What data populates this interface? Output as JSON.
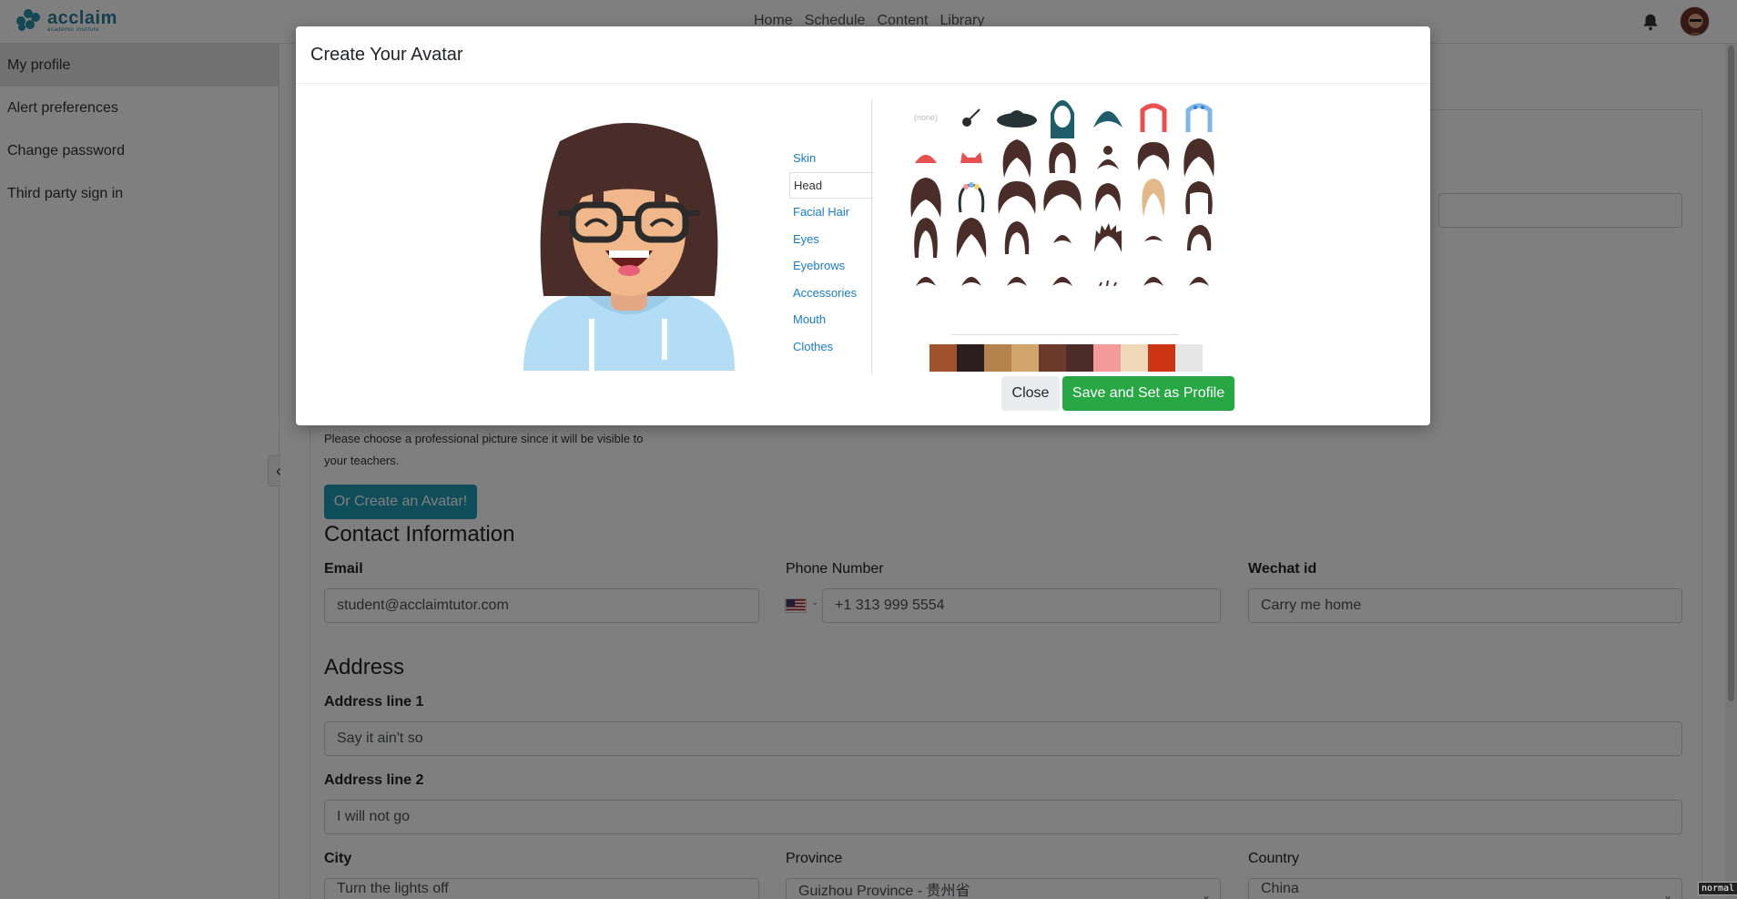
{
  "brand": {
    "name": "acclaim",
    "subtitle": "academic institute"
  },
  "nav": {
    "links": [
      "Home",
      "Schedule",
      "Content",
      "Library"
    ]
  },
  "sidebar": {
    "items": [
      {
        "label": "My profile",
        "active": true
      },
      {
        "label": "Alert preferences"
      },
      {
        "label": "Change password"
      },
      {
        "label": "Third party sign in"
      }
    ]
  },
  "profile": {
    "picture_hint": "Please choose a professional picture since it will be visible to your teachers.",
    "create_avatar_button": "Or Create an Avatar!"
  },
  "contact": {
    "title": "Contact Information",
    "email_label": "Email",
    "email_value": "student@acclaimtutor.com",
    "phone_label": "Phone Number",
    "phone_value": "+1 313 999 5554",
    "wechat_label": "Wechat id",
    "wechat_value": "Carry me home"
  },
  "address": {
    "title": "Address",
    "line1_label": "Address line 1",
    "line1_value": "Say it ain't so",
    "line2_label": "Address line 2",
    "line2_value": "I will not go",
    "city_label": "City",
    "city_value": "Turn the lights off",
    "province_label": "Province",
    "province_value": "Guizhou Province - 贵州省",
    "country_label": "Country",
    "country_value": "China"
  },
  "modal": {
    "title": "Create Your Avatar",
    "tabs": [
      "Skin",
      "Head",
      "Facial Hair",
      "Eyes",
      "Eyebrows",
      "Accessories",
      "Mouth",
      "Clothes"
    ],
    "active_tab": "Head",
    "none_option": "(none)",
    "palette": [
      "#a0532a",
      "#2b1e1e",
      "#b5824d",
      "#d2a56c",
      "#6b3a2a",
      "#4a2c28",
      "#f59a9a",
      "#eed9b8",
      "#cc3311",
      "#e6e6e6"
    ],
    "close_button": "Close",
    "save_button": "Save and Set as Profile"
  },
  "status": {
    "mode": "normal"
  },
  "colors": {
    "accent": "#1f9bb5",
    "success": "#28a745",
    "link": "#1a7cc9",
    "hair": "#4a2c28"
  }
}
